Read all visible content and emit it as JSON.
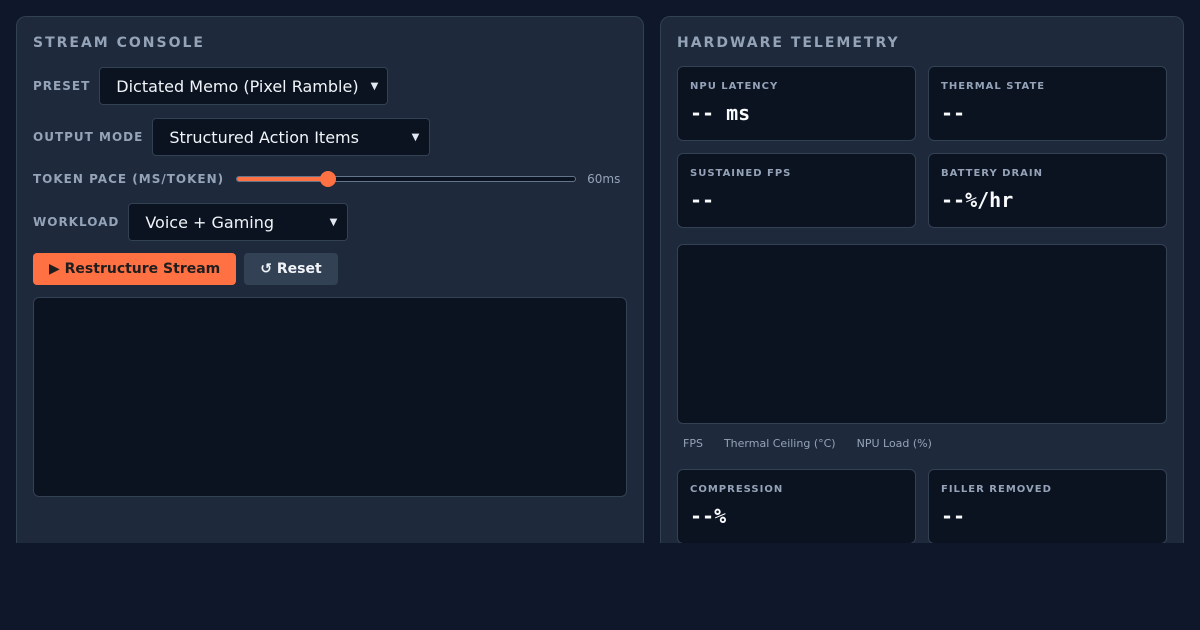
{
  "console": {
    "title": "STREAM CONSOLE",
    "preset": {
      "label": "PRESET",
      "value": "Dictated Memo (Pixel Ramble)"
    },
    "output_mode": {
      "label": "OUTPUT MODE",
      "value": "Structured Action Items"
    },
    "token_pace": {
      "label": "TOKEN PACE (MS/TOKEN)",
      "value": "60ms",
      "fraction": 0.27
    },
    "workload": {
      "label": "WORKLOAD",
      "value": "Voice + Gaming"
    },
    "restructure_label": "▶ Restructure Stream",
    "reset_label": "↺ Reset",
    "output_text": ""
  },
  "telemetry": {
    "title": "HARDWARE TELEMETRY",
    "npu_latency": {
      "label": "NPU LATENCY",
      "value": "-- ms"
    },
    "thermal_state": {
      "label": "THERMAL STATE",
      "value": "--"
    },
    "sustained_fps": {
      "label": "SUSTAINED FPS",
      "value": "--"
    },
    "battery_drain": {
      "label": "BATTERY DRAIN",
      "value": "--%/hr"
    },
    "legend": [
      "FPS",
      "Thermal Ceiling (°C)",
      "NPU Load (%)"
    ],
    "compression": {
      "label": "COMPRESSION",
      "value": "--%"
    },
    "filler_removed": {
      "label": "FILLER REMOVED",
      "value": "--"
    }
  },
  "colors": {
    "accent": "#ff7043",
    "background": "#0f172a",
    "panel": "#1e293b",
    "field": "#0b1220"
  }
}
